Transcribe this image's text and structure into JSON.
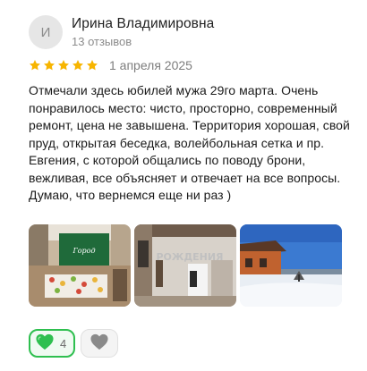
{
  "review": {
    "avatar_letter": "И",
    "author_name": "Ирина Владимировна",
    "review_count": "13 отзывов",
    "rating": 5,
    "rating_max": 5,
    "star_color": "#f7b500",
    "date": "1 апреля 2025",
    "text": "Отмечали здесь юбилей мужа 29го марта. Очень понравилось место: чисто, просторно, современный ремонт, цена не завышена. Территория хорошая, свой пруд, открытая беседка, волейбольная сетка и пр. Евгения, с которой общались по поводу брони, вежливая, все объясняет и отвечает на все вопросы. Думаю, что вернемся еще ни раз )",
    "photos": [
      {
        "label": "banquet-hall-photo",
        "sign_text": "Город"
      },
      {
        "label": "decorated-room-photo",
        "banner_text": "РОЖДЕНИЯ"
      },
      {
        "label": "house-exterior-photo"
      }
    ],
    "reactions": {
      "like_count": "4",
      "like_icon": "green-heart-icon",
      "dislike_icon": "gray-heart-icon",
      "like_color": "#2ebf4f"
    }
  }
}
